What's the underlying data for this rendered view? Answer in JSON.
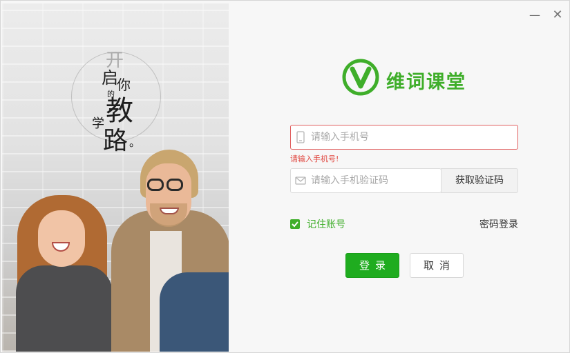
{
  "window": {
    "minimize_symbol": "—",
    "close_symbol": "✕"
  },
  "hero": {
    "slogan_chars": [
      "开",
      "启",
      "你",
      "的",
      "教",
      "学",
      "路",
      "。"
    ]
  },
  "brand": {
    "logo_letter": "V",
    "name": "维词课堂",
    "color": "#3fae2a"
  },
  "form": {
    "phone_placeholder": "请输入手机号",
    "phone_value": "",
    "phone_error": "请输入手机号!",
    "code_placeholder": "请输入手机验证码",
    "code_value": "",
    "get_code_label": "获取验证码",
    "remember_label": "记住账号",
    "remember_checked": true,
    "password_login_label": "密码登录",
    "login_label": "登录",
    "cancel_label": "取消"
  },
  "icons": {
    "phone": "mobile-phone-icon",
    "code": "envelope-icon",
    "check": "checkmark-icon",
    "logo": "v-circle-logo-icon"
  },
  "colors": {
    "accent": "#3fae2a",
    "login_button": "#1fac1f",
    "error": "#e0463f"
  }
}
